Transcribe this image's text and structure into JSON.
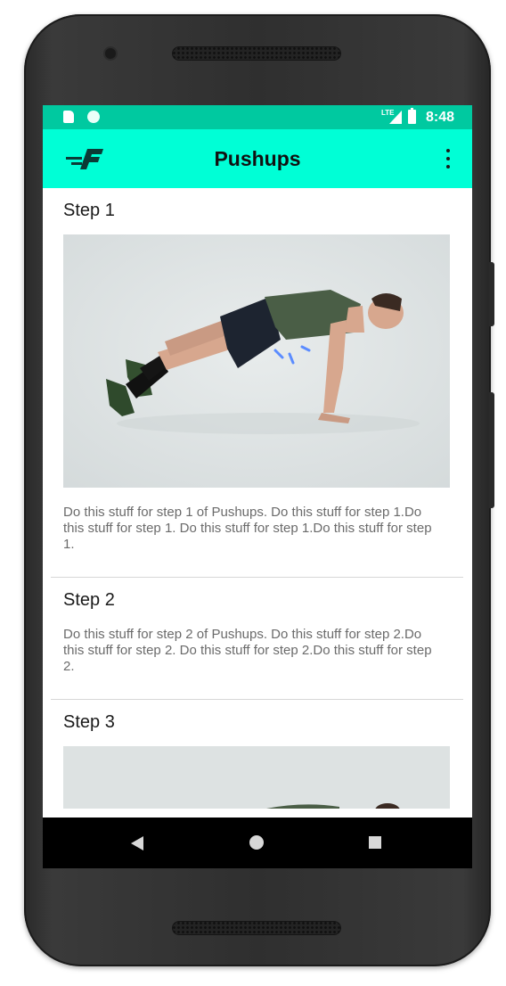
{
  "status_bar": {
    "network": "LTE",
    "time": "8:48"
  },
  "app_bar": {
    "logo_icon": "fitness-app-logo-icon",
    "title": "Pushups",
    "overflow_icon": "more-vert-icon"
  },
  "steps": [
    {
      "title": "Step 1",
      "description": "Do this stuff for step 1 of Pushups. Do this stuff for step 1.Do this stuff for step 1. Do this stuff for step 1.Do this stuff for step 1.",
      "has_image": true
    },
    {
      "title": "Step 2",
      "description": "Do this stuff for step 2 of Pushups. Do this stuff for step 2.Do this stuff for step 2. Do this stuff for step 2.Do this stuff for step 2.",
      "has_image": false
    },
    {
      "title": "Step 3",
      "has_image": true
    }
  ],
  "nav_bar": {
    "back_icon": "back-triangle-icon",
    "home_icon": "home-circle-icon",
    "recents_icon": "recents-square-icon"
  },
  "colors": {
    "status_bar": "#00C9A0",
    "app_bar": "#00FFD6",
    "nav_bar": "#000000",
    "text_primary": "#1a1a1a",
    "text_secondary": "#6b6b6b",
    "photo_background": "#dde2e2"
  }
}
